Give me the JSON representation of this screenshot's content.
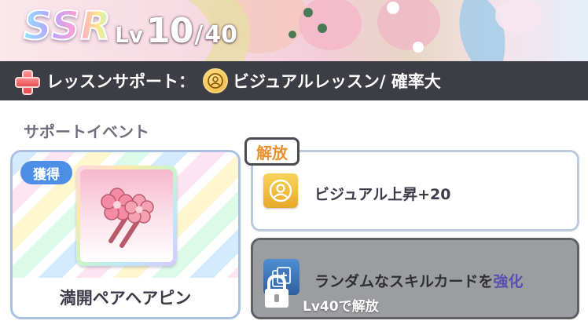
{
  "header": {
    "rarity": "SSR",
    "level_prefix": "Lv",
    "level_current": "10",
    "level_separator": "/",
    "level_max": "40"
  },
  "support_bar": {
    "label": "レッスンサポート：",
    "value": "ビジュアルレッスン/ 確率大",
    "plus_icon": "plus-icon",
    "visual_icon": "visual-icon"
  },
  "support_events": {
    "title": "サポートイベント",
    "item": {
      "badge": "獲得",
      "name": "満開ペアヘアピン",
      "icon": "sakura-hairpin-icon"
    },
    "unlock_tag": "解放",
    "effect": {
      "icon": "visual-icon",
      "text": "ビジュアル上昇+20"
    },
    "locked_effect": {
      "icon": "skill-card-icon",
      "text_main": "ランダムなスキルカードを",
      "text_highlight": "強化",
      "lock_label": "Lv40で解放"
    }
  },
  "colors": {
    "bar_background": "#3d3e45",
    "badge_blue": "#4d8fe6",
    "unlock_orange": "#e8912e",
    "highlight_purple": "#5b4fb0",
    "locked_gray": "#9c9da1"
  }
}
